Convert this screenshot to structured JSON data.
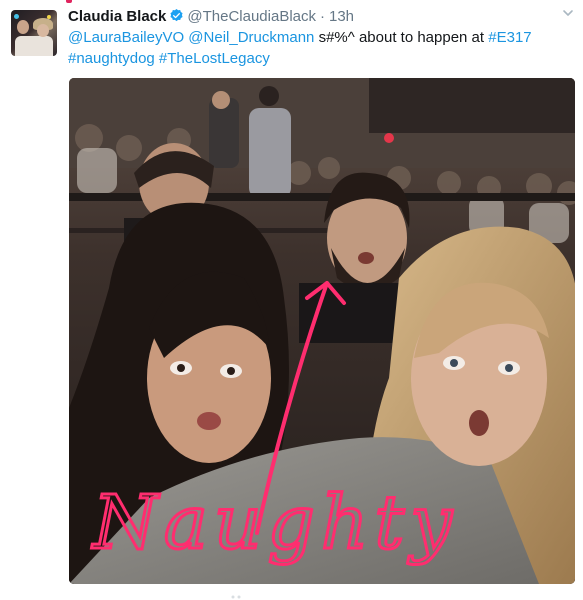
{
  "tweet": {
    "author_name": "Claudia Black",
    "handle": "@TheClaudiaBlack",
    "separator": "·",
    "time": "13h",
    "text_segments": [
      {
        "text": "@LauraBaileyVO",
        "type": "mention"
      },
      {
        "text": " ",
        "type": "plain"
      },
      {
        "text": "@Neil_Druckmann",
        "type": "mention"
      },
      {
        "text": " s#%^ about to happen at ",
        "type": "plain"
      },
      {
        "text": "#E317",
        "type": "hashtag"
      },
      {
        "text": " ",
        "type": "plain"
      },
      {
        "text": "#naughtydog",
        "type": "hashtag"
      },
      {
        "text": " ",
        "type": "plain"
      },
      {
        "text": "#TheLostLegacy",
        "type": "hashtag"
      }
    ],
    "photo_handwriting": "Naughty"
  },
  "icons": {
    "verified": "verified-badge-icon",
    "menu": "chevron-down-icon"
  },
  "colors": {
    "link": "#1b95e0",
    "verified": "#1da1f2",
    "secondary_text": "#657786",
    "annotation_pink": "#ff2d6f"
  }
}
